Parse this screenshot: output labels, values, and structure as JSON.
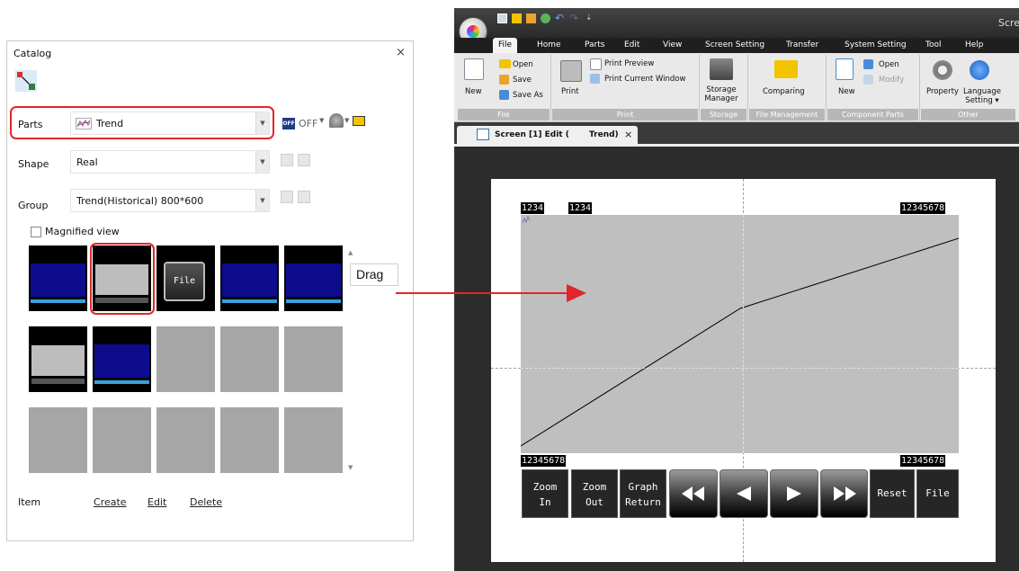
{
  "catalog": {
    "title": "Catalog",
    "close": "×",
    "parts_label": "Parts",
    "parts_value": "Trend",
    "off_badge": "OFF",
    "off_label": "OFF",
    "shape_label": "Shape",
    "shape_value": "Real",
    "group_label": "Group",
    "group_value": "Trend(Historical) 800*600",
    "magnified_label": "Magnified view",
    "thumb_file_label": "File",
    "item_label": "Item",
    "create": "Create",
    "edit": "Edit",
    "delete": "Delete"
  },
  "annotation": {
    "drag": "Drag",
    "accent": "#e0262a"
  },
  "editor": {
    "title_fragment": "Scre",
    "quick_access_more": "⇣",
    "tabs": [
      "File",
      "Home",
      "Parts",
      "Edit",
      "View",
      "Screen Setting",
      "Transfer",
      "System Setting",
      "Tool",
      "Help"
    ],
    "ribbon": {
      "new": "New",
      "open": "Open",
      "save": "Save",
      "save_as": "Save As",
      "print": "Print",
      "print_preview": "Print Preview",
      "print_current_window": "Print Current Window",
      "storage_manager_1": "Storage",
      "storage_manager_2": "Manager",
      "comparing": "Comparing",
      "comp_new": "New",
      "comp_open": "Open",
      "comp_modify": "Modify",
      "property": "Property",
      "language_setting_1": "Language",
      "language_setting_2": "Setting ▾",
      "groups": [
        "File",
        "Print",
        "Storage",
        "File Management",
        "Component Parts",
        "Other"
      ]
    },
    "doc_tab_a": "Screen [1] Edit (",
    "doc_tab_b": "Trend)",
    "doc_tab_close": "×",
    "trend": {
      "num_small_1": "1234",
      "num_small_2": "1234",
      "num_right_top": "12345678",
      "num_left_bottom": "12345678",
      "num_right_bottom": "12345678",
      "zoom_in_1": "Zoom",
      "zoom_in_2": "In",
      "zoom_out_1": "Zoom",
      "zoom_out_2": "Out",
      "graph_return_1": "Graph",
      "graph_return_2": "Return",
      "reset": "Reset",
      "file": "File"
    }
  }
}
